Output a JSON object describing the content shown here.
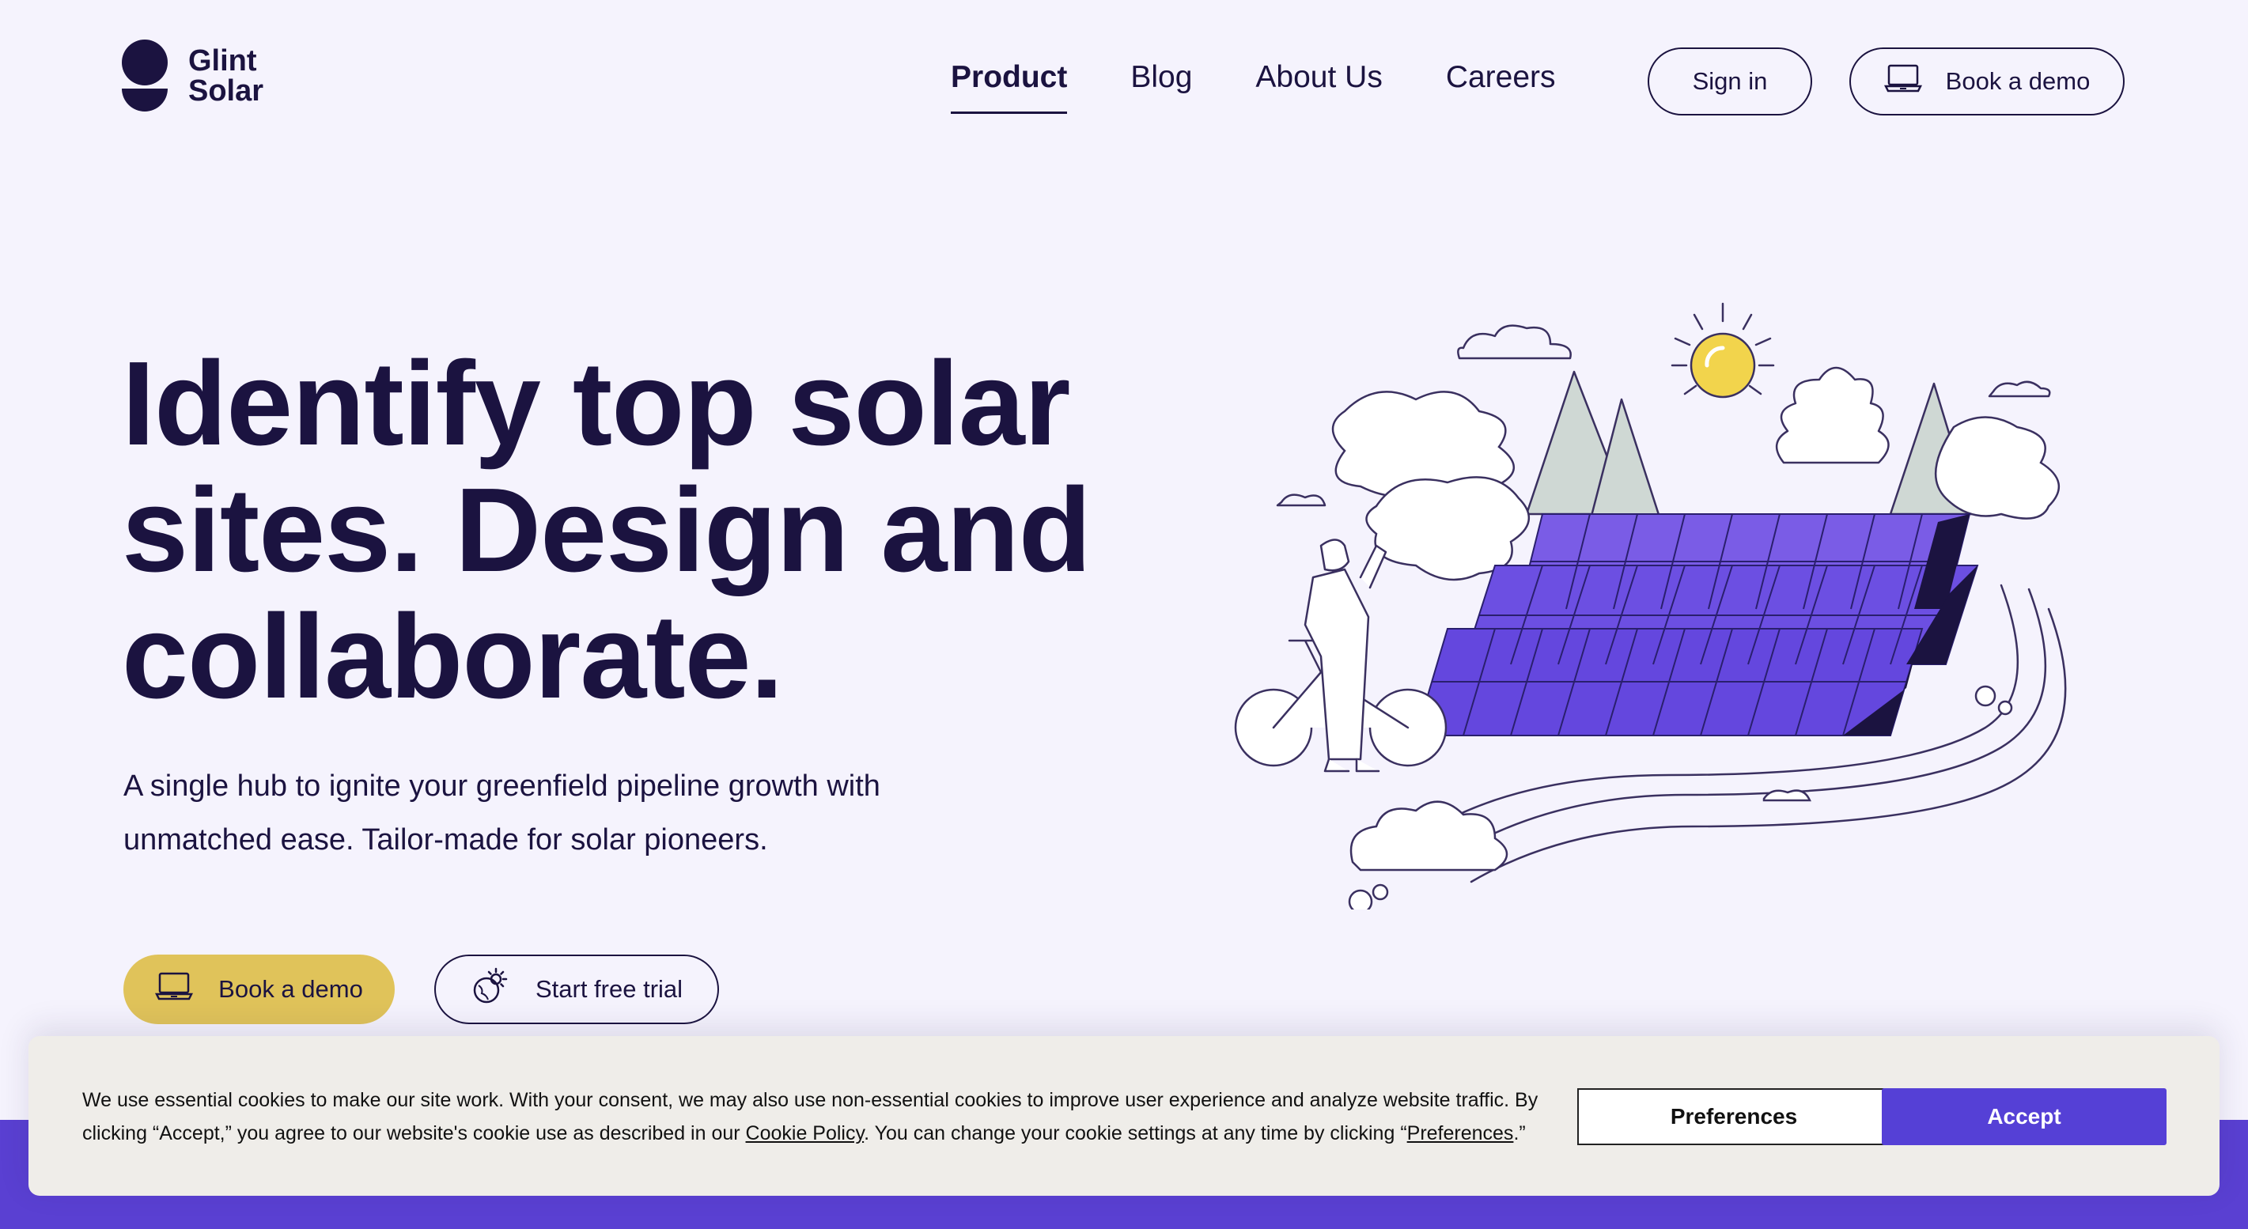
{
  "brand": {
    "name": "Glint\nSolar"
  },
  "nav": {
    "items": [
      {
        "label": "Product",
        "active": true
      },
      {
        "label": "Blog"
      },
      {
        "label": "About Us"
      },
      {
        "label": "Careers"
      }
    ]
  },
  "header_actions": {
    "sign_in": "Sign in",
    "book_demo": "Book a demo"
  },
  "hero": {
    "title": "Identify top solar sites. Design and collaborate.",
    "subtitle": "A single hub to ignite your greenfield pipeline growth with unmatched ease. Tailor-made for solar pioneers.",
    "cta_demo": "Book a demo",
    "cta_trial": "Start free trial"
  },
  "cookie": {
    "text_1": "We use essential cookies to make our site work. With your consent, we may also use non-essential cookies to improve user experience and analyze website traffic. By clicking “Accept,” you agree to our website's cookie use as described in our ",
    "policy_link": "Cookie Policy",
    "text_2": ". You can change your cookie settings at any time by clicking “",
    "preferences_link": "Preferences",
    "text_3": ".”",
    "preferences_button": "Preferences",
    "accept_button": "Accept"
  },
  "colors": {
    "background": "#f5f3fd",
    "ink": "#1b1340",
    "accent_yellow": "#e0c35a",
    "accent_purple": "#5540d6",
    "panel_purple": "#6a4fe0"
  },
  "icons": [
    "laptop-icon",
    "solar-globe-icon"
  ]
}
